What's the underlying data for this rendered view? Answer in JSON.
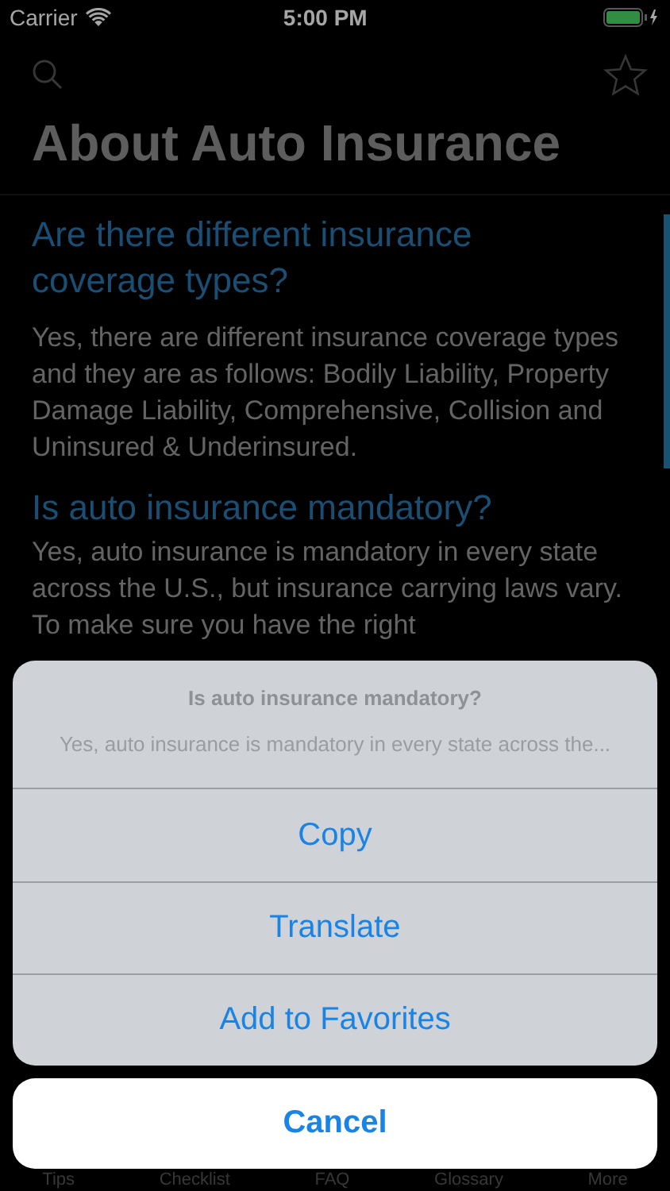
{
  "status_bar": {
    "carrier": "Carrier",
    "time": "5:00 PM"
  },
  "title": "About Auto Insurance",
  "sections": [
    {
      "question": "Are there different insurance coverage types?",
      "answer": "Yes, there are different insurance coverage types and they are as follows: Bodily Liability, Property Damage Liability, Comprehensive, Collision and Uninsured & Underinsured."
    },
    {
      "question": "Is auto insurance mandatory?",
      "answer": "Yes, auto insurance is mandatory in every state across the U.S., but insurance carrying laws vary. To make sure you have the right"
    }
  ],
  "tab_bar": [
    "Tips",
    "Checklist",
    "FAQ",
    "Glossary",
    "More"
  ],
  "action_sheet": {
    "title": "Is auto insurance mandatory?",
    "message": "Yes, auto insurance is mandatory in every state across the...",
    "actions": [
      "Copy",
      "Translate",
      "Add to Favorites"
    ],
    "cancel": "Cancel"
  }
}
